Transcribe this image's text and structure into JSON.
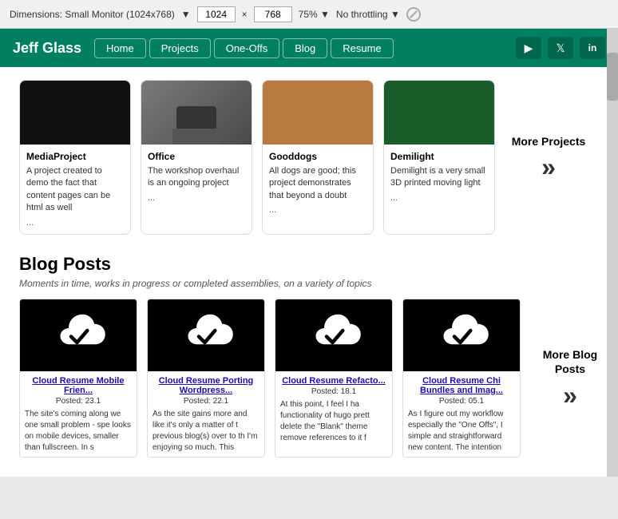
{
  "toolbar": {
    "dimensions_label": "Dimensions: Small Monitor (1024x768)",
    "width": "1024",
    "height": "768",
    "zoom": "75%",
    "throttle": "No throttling"
  },
  "nav": {
    "brand": "Jeff Glass",
    "links": [
      "Home",
      "Projects",
      "One-Offs",
      "Blog",
      "Resume"
    ],
    "icons": [
      "youtube",
      "twitter",
      "linkedin"
    ]
  },
  "projects": {
    "cards": [
      {
        "title": "MediaProject",
        "desc": "A project created to demo the fact that content pages can be html as well",
        "more": "...",
        "thumb_style": "media"
      },
      {
        "title": "Office",
        "desc": "The workshop overhaul is an ongoing project",
        "more": "...",
        "thumb_style": "office"
      },
      {
        "title": "Gooddogs",
        "desc": "All dogs are good; this project demonstrates that beyond a doubt",
        "more": "...",
        "thumb_style": "gooddogs"
      },
      {
        "title": "Demilight",
        "desc": "Demilight is a very small 3D printed moving light",
        "more": "...",
        "thumb_style": "demilight"
      }
    ],
    "more_label": "More Projects"
  },
  "blog": {
    "section_title": "Blog Posts",
    "section_subtitle": "Moments in time, works in progress or completed assemblies, on a variety of topics",
    "cards": [
      {
        "title": "Cloud Resume Mobile Frien...",
        "date": "Posted: 23.1",
        "excerpt": "The site's coming along we one small problem - spe looks on mobile devices, smaller than fullscreen. In s"
      },
      {
        "title": "Cloud Resume Porting Wordpress...",
        "date": "Posted: 22.1",
        "excerpt": "As the site gains more and like it's only a matter of t previous blog(s) over to th I'm enjoying so much. This"
      },
      {
        "title": "Cloud Resume Refacto...",
        "date": "Posted: 18.1",
        "excerpt": "At this point, I feel I ha functionality of hugo prett delete the \"Blank\" theme remove references to it f"
      },
      {
        "title": "Cloud Resume Chi Bundles and Imag...",
        "date": "Posted: 05.1",
        "excerpt": "As I figure out my workflow especially the \"One Offs\", I simple and straightforward new content. The intention"
      }
    ],
    "more_label": "More Blog\nPosts"
  }
}
